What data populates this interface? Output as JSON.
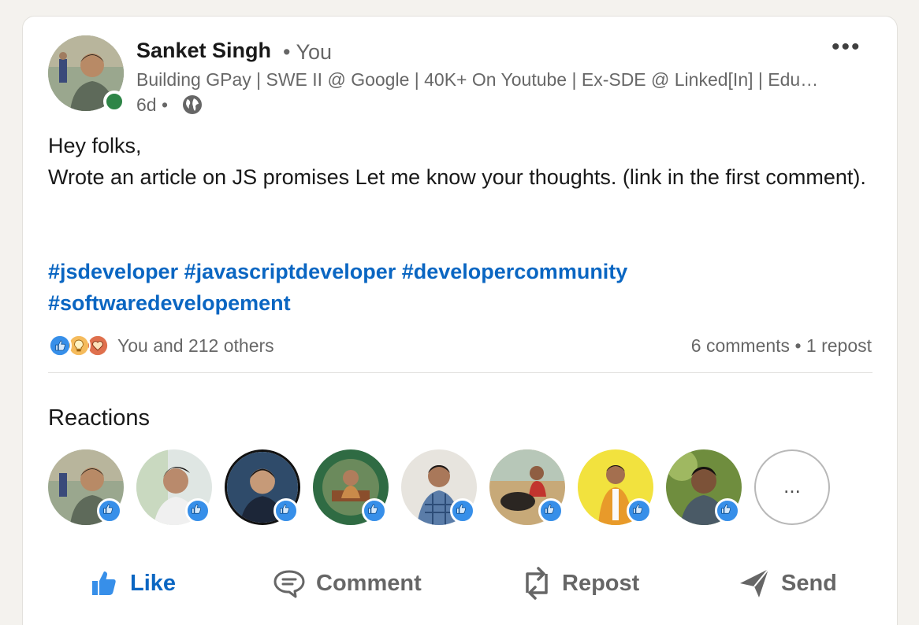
{
  "post": {
    "author": {
      "name": "Sanket Singh",
      "relation": "• You",
      "headline": "Building GPay | SWE II @ Google | 40K+ On Youtube | Ex-SDE @ Linked[In] | Educator | Scaler | JavaScript | DSA",
      "time": "6d •",
      "visibility_icon": "globe-icon",
      "status_color": "#2e8547"
    },
    "menu_label": "•••",
    "body": {
      "line1": "Hey folks,",
      "line2": "Wrote an article on JS promises Let me know your thoughts. (link in the first comment)."
    },
    "hashtags": {
      "line1": "#jsdeveloper #javascriptdeveloper #developercommunity",
      "line2": "#softwaredevelopement"
    },
    "social": {
      "reaction_icons": [
        "like-icon",
        "insightful-icon",
        "love-icon"
      ],
      "reactions_text": "You and 212 others",
      "counts_text": "6 comments • 1 repost"
    },
    "reactions_section": {
      "title": "Reactions",
      "more_label": "..."
    },
    "actions": {
      "like": "Like",
      "comment": "Comment",
      "repost": "Repost",
      "send": "Send"
    }
  },
  "colors": {
    "accent": "#0a66c2",
    "like_badge": "#378fe9",
    "background": "#f4f2ee"
  }
}
